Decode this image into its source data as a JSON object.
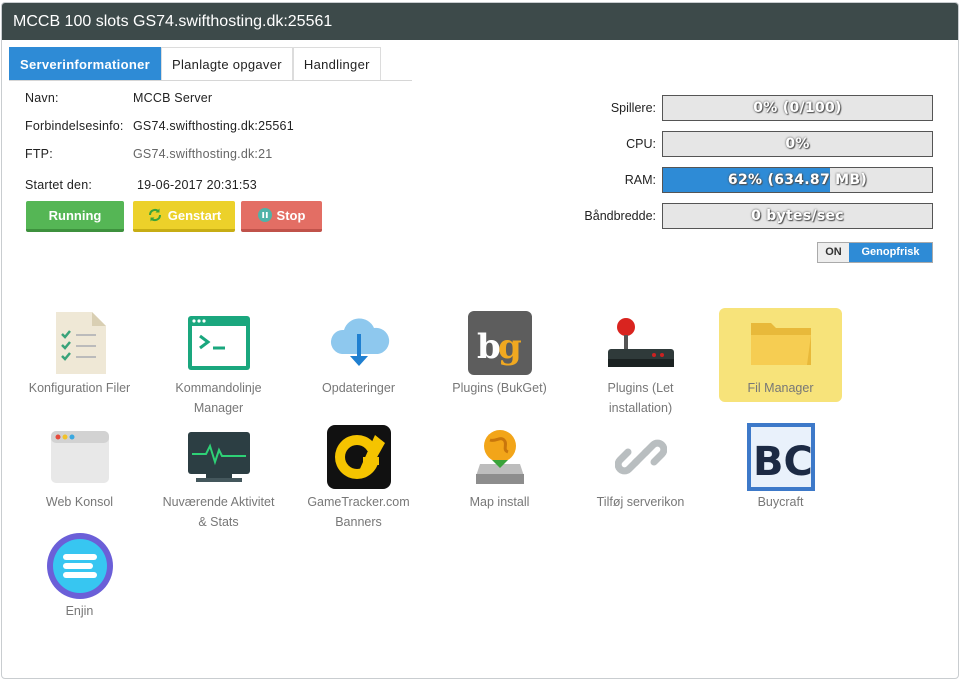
{
  "window": {
    "title": "MCCB 100 slots GS74.swifthosting.dk:25561"
  },
  "tabs": [
    {
      "label": "Serverinformationer",
      "active": true
    },
    {
      "label": "Planlagte opgaver",
      "active": false
    },
    {
      "label": "Handlinger",
      "active": false
    }
  ],
  "info": {
    "name_label": "Navn:",
    "name_value": "MCCB Server",
    "conn_label": "Forbindelsesinfo:",
    "conn_value": "GS74.swifthosting.dk:25561",
    "ftp_label": "FTP:",
    "ftp_value": "GS74.swifthosting.dk:21",
    "started_label": "Startet den:",
    "started_value": "19-06-2017 20:31:53"
  },
  "buttons": {
    "running": "Running",
    "restart": "Genstart",
    "stop": "Stop"
  },
  "stats": [
    {
      "label": "Spillere:",
      "text": "0% (0/100)",
      "fraction": 0.0
    },
    {
      "label": "CPU:",
      "text": "0%",
      "fraction": 0.0
    },
    {
      "label": "RAM:",
      "text": "62% (634.87 MB)",
      "fraction": 0.62
    },
    {
      "label": "Båndbredde:",
      "text": "0 bytes/sec",
      "fraction": 0.0
    }
  ],
  "toggle": {
    "state": "ON",
    "refresh": "Genopfrisk"
  },
  "tiles": [
    {
      "icon": "config-files-icon",
      "label": "Konfiguration Filer"
    },
    {
      "icon": "terminal-icon",
      "label": "Kommandolinje Manager"
    },
    {
      "icon": "cloud-download-icon",
      "label": "Opdateringer"
    },
    {
      "icon": "bukget-icon",
      "label": "Plugins (BukGet)"
    },
    {
      "icon": "joystick-icon",
      "label": "Plugins (Let installation)"
    },
    {
      "icon": "folder-icon",
      "label": "Fil Manager",
      "highlighted": true
    },
    {
      "icon": "browser-window-icon",
      "label": "Web Konsol"
    },
    {
      "icon": "activity-monitor-icon",
      "label": "Nuværende Aktivitet & Stats"
    },
    {
      "icon": "gametracker-icon",
      "label": "GameTracker.com Banners"
    },
    {
      "icon": "map-install-icon",
      "label": "Map install"
    },
    {
      "icon": "link-icon",
      "label": "Tilføj serverikon"
    },
    {
      "icon": "buycraft-icon",
      "label": "Buycraft"
    },
    {
      "icon": "enjin-icon",
      "label": "Enjin"
    }
  ],
  "colors": {
    "accent": "#2e8bd6",
    "titlebar": "#3d4a4a",
    "running": "#55b655",
    "restart": "#ecd12a",
    "stop": "#e36e64",
    "highlight": "#f7e37a"
  }
}
